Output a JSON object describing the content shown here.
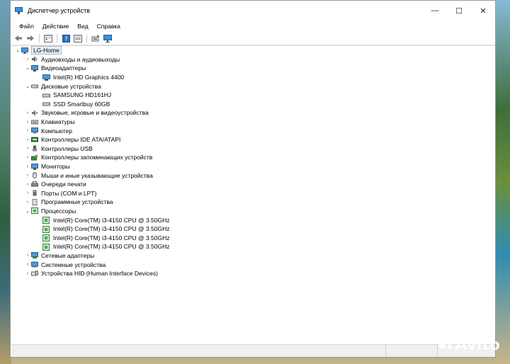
{
  "window": {
    "title": "Диспетчер устройств",
    "controls": [
      "—",
      "☐",
      "✕"
    ]
  },
  "menu": [
    "Файл",
    "Действие",
    "Вид",
    "Справка"
  ],
  "toolbar": [
    "back-icon",
    "forward-icon",
    "properties-icon",
    "help-icon",
    "view-icon",
    "update-driver-icon",
    "scan-hardware-icon"
  ],
  "tree": {
    "root": "LG-Home",
    "categories": [
      {
        "label": "Аудиовходы и аудиовыходы",
        "expanded": false,
        "icon": "audio-icon"
      },
      {
        "label": "Видеоадаптеры",
        "expanded": true,
        "icon": "display-adapter-icon",
        "children": [
          "Intel(R) HD Graphics 4400"
        ]
      },
      {
        "label": "Дисковые устройства",
        "expanded": true,
        "icon": "disk-drive-icon",
        "children": [
          "SAMSUNG HD161HJ",
          "SSD Smartbuy 60GB"
        ]
      },
      {
        "label": "Звуковые, игровые и видеоустройства",
        "expanded": false,
        "icon": "sound-icon"
      },
      {
        "label": "Клавиатуры",
        "expanded": false,
        "icon": "keyboard-icon"
      },
      {
        "label": "Компьютер",
        "expanded": false,
        "icon": "computer-icon"
      },
      {
        "label": "Контроллеры IDE ATA/ATAPI",
        "expanded": false,
        "icon": "ide-controller-icon"
      },
      {
        "label": "Контроллеры USB",
        "expanded": false,
        "icon": "usb-icon"
      },
      {
        "label": "Контроллеры запоминающих устройств",
        "expanded": false,
        "icon": "storage-controller-icon"
      },
      {
        "label": "Мониторы",
        "expanded": false,
        "icon": "monitor-icon"
      },
      {
        "label": "Мыши и иные указывающие устройства",
        "expanded": false,
        "icon": "mouse-icon"
      },
      {
        "label": "Очереди печати",
        "expanded": false,
        "icon": "print-queue-icon"
      },
      {
        "label": "Порты (COM и LPT)",
        "expanded": false,
        "icon": "port-icon"
      },
      {
        "label": "Программные устройства",
        "expanded": false,
        "icon": "software-device-icon"
      },
      {
        "label": "Процессоры",
        "expanded": true,
        "icon": "processor-icon",
        "children": [
          "Intel(R) Core(TM) i3-4150 CPU @ 3.50GHz",
          "Intel(R) Core(TM) i3-4150 CPU @ 3.50GHz",
          "Intel(R) Core(TM) i3-4150 CPU @ 3.50GHz",
          "Intel(R) Core(TM) i3-4150 CPU @ 3.50GHz"
        ]
      },
      {
        "label": "Сетевые адаптеры",
        "expanded": false,
        "icon": "network-adapter-icon"
      },
      {
        "label": "Системные устройства",
        "expanded": false,
        "icon": "system-device-icon"
      },
      {
        "label": "Устройства HID (Human Interface Devices)",
        "expanded": false,
        "icon": "hid-icon"
      }
    ]
  },
  "watermark": "Avito",
  "colors": {
    "selection": "#e5f1fb",
    "accent": "#3d8fd6"
  }
}
